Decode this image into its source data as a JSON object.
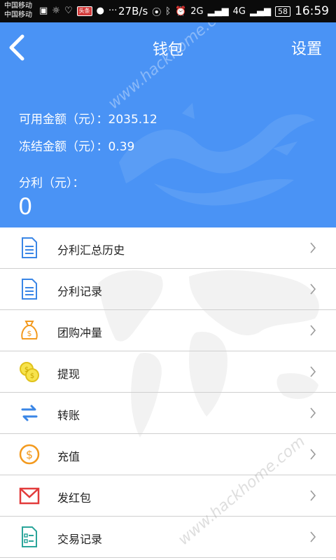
{
  "status_bar": {
    "carrier_1": "中国移动",
    "carrier_2": "中国移动",
    "left_badge": "头条",
    "left_icons": [
      "image-icon",
      "sun-icon",
      "heart-icon",
      "toutiao-icon",
      "wechat-icon",
      "more-icon"
    ],
    "speed": "27B/s",
    "net_2g": "2G",
    "net_4g": "4G",
    "battery": "58",
    "time": "16:59"
  },
  "header": {
    "back_icon": "back-chevron-icon",
    "title": "钱包",
    "settings_label": "设置",
    "background_color": "#4a93f5"
  },
  "balances": {
    "available_label": "可用金额（元）：",
    "available_value": "2035.12",
    "frozen_label": "冻结金额（元）：",
    "frozen_value": "0.39",
    "profit_label": "分利（元）：",
    "profit_value": "0"
  },
  "menu": {
    "items": [
      {
        "label": "分利汇总历史",
        "icon": "document-icon"
      },
      {
        "label": "分利记录",
        "icon": "document-icon"
      },
      {
        "label": "团购冲量",
        "icon": "money-bag-icon"
      },
      {
        "label": "提现",
        "icon": "coins-icon"
      },
      {
        "label": "转账",
        "icon": "transfer-arrows-icon"
      },
      {
        "label": "充值",
        "icon": "dollar-circle-icon"
      },
      {
        "label": "发红包",
        "icon": "envelope-icon"
      },
      {
        "label": "交易记录",
        "icon": "checklist-icon"
      }
    ]
  },
  "watermarks": [
    "www.hackhome.com",
    "www.hackhome.com"
  ],
  "colors": {
    "accent_blue": "#4a93f5",
    "orange": "#f39a1e",
    "yellow": "#f0cf2a",
    "red": "#e23b3b",
    "teal": "#2aa59a"
  }
}
